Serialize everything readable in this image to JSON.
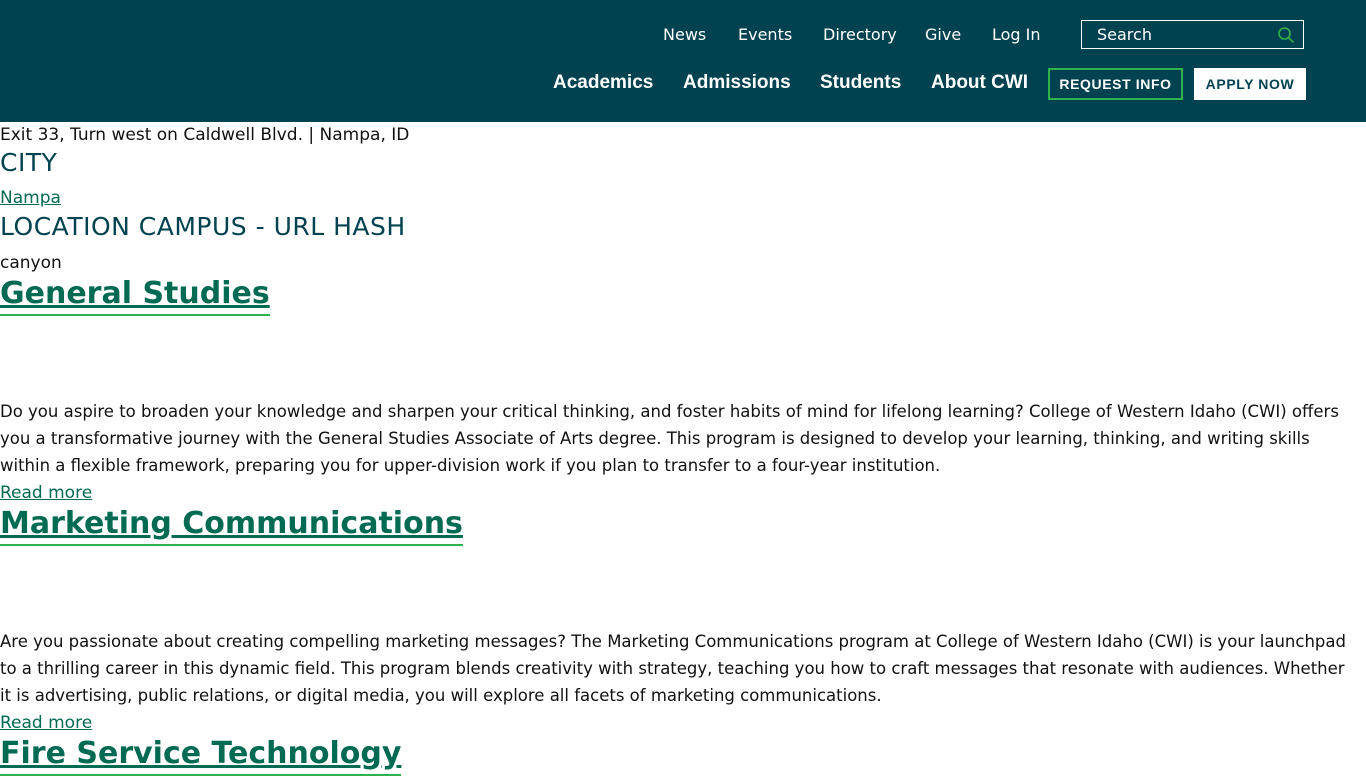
{
  "header": {
    "utility_nav": [
      {
        "label": "News"
      },
      {
        "label": "Events"
      },
      {
        "label": "Directory"
      },
      {
        "label": "Give"
      },
      {
        "label": "Log In"
      }
    ],
    "search": {
      "placeholder": "Search"
    },
    "main_nav": [
      {
        "label": "Academics"
      },
      {
        "label": "Admissions"
      },
      {
        "label": "Students"
      },
      {
        "label": "About CWI"
      }
    ],
    "request_info_label": "REQUEST INFO",
    "apply_now_label": "APPLY NOW"
  },
  "location": {
    "directions": "Exit 33, Turn west on Caldwell Blvd. | Nampa, ID",
    "city_label": "CITY",
    "city_value": "Nampa",
    "campus_hash_label": "LOCATION CAMPUS - URL HASH",
    "campus_hash_value": "canyon"
  },
  "programs": [
    {
      "title": "General Studies",
      "description": "Do you aspire to broaden your knowledge and sharpen your critical thinking, and foster habits of mind for lifelong learning? College of Western Idaho (CWI) offers you a transformative journey with the General Studies Associate of Arts degree. This program is designed to develop your learning, thinking, and writing skills within a flexible framework, preparing you for upper-division work if you plan to transfer to a four-year institution.",
      "read_more": "Read more"
    },
    {
      "title": "Marketing Communications",
      "description": "Are you passionate about creating compelling marketing messages? The Marketing Communications program at College of Western Idaho (CWI) is your launchpad to a thrilling career in this dynamic field. This program blends creativity with strategy, teaching you how to craft messages that resonate with audiences. Whether it is advertising, public relations, or digital media, you will explore all facets of marketing communications.",
      "read_more": "Read more"
    },
    {
      "title": "Fire Service Technology"
    }
  ],
  "colors": {
    "header_bg": "#004250",
    "accent_green": "#2fb24c",
    "link_green": "#006a52"
  }
}
